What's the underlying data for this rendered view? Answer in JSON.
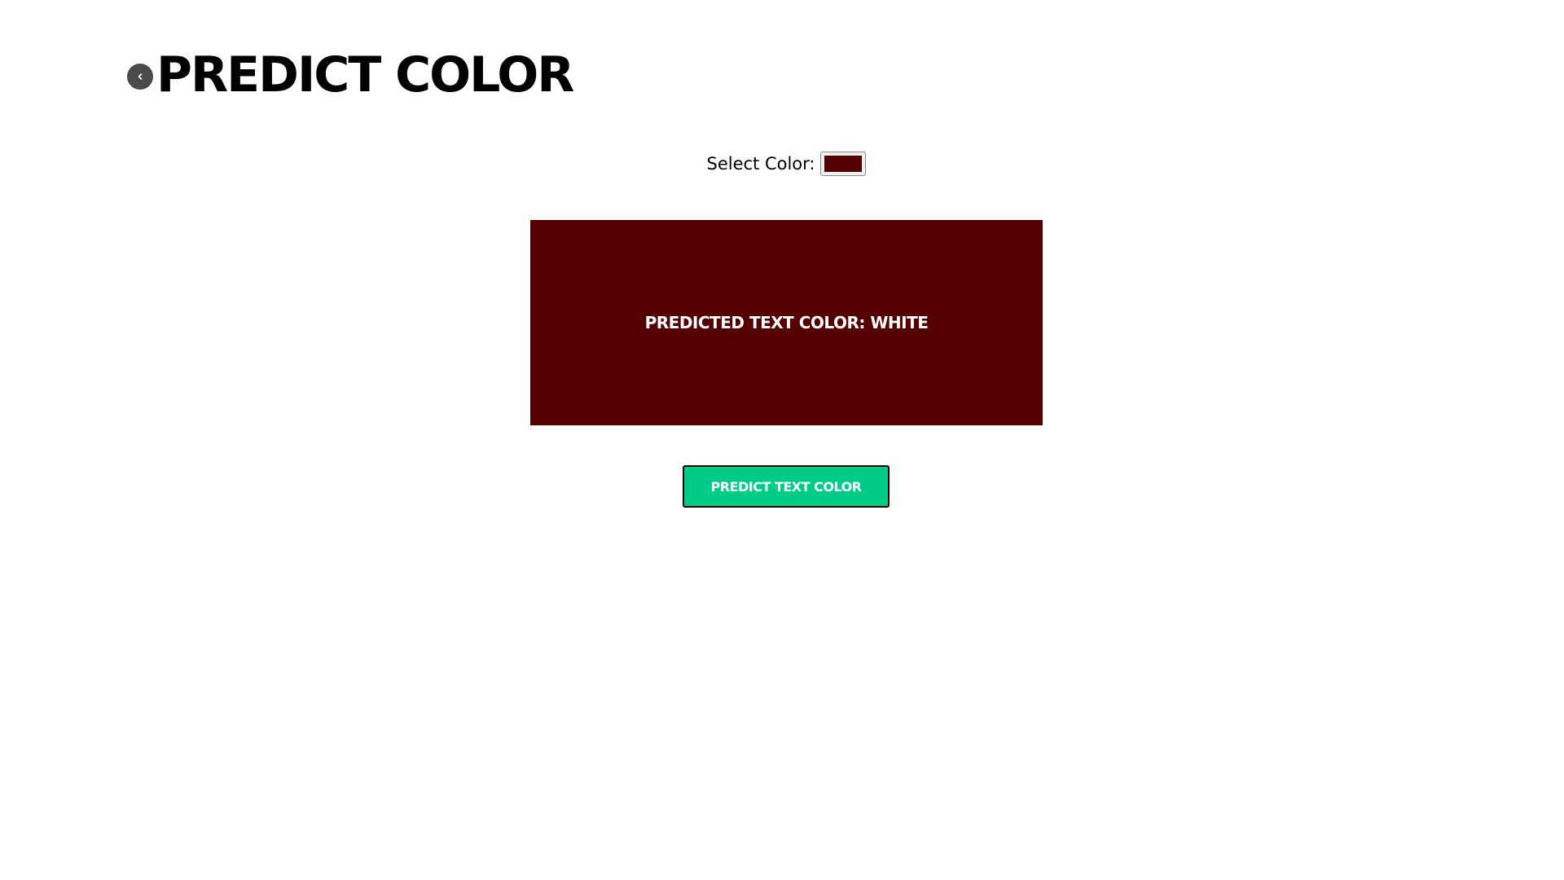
{
  "header": {
    "title": "PREDICT COLOR",
    "back_icon": "chevron-left-icon"
  },
  "picker": {
    "label": "Select Color:",
    "value": "#550000"
  },
  "preview": {
    "text": "PREDICTED TEXT COLOR: WHITE",
    "background": "#550000",
    "text_color": "#ffffff"
  },
  "action": {
    "label": "PREDICT TEXT COLOR",
    "background": "#00cc88",
    "text_color": "#ffffff"
  }
}
